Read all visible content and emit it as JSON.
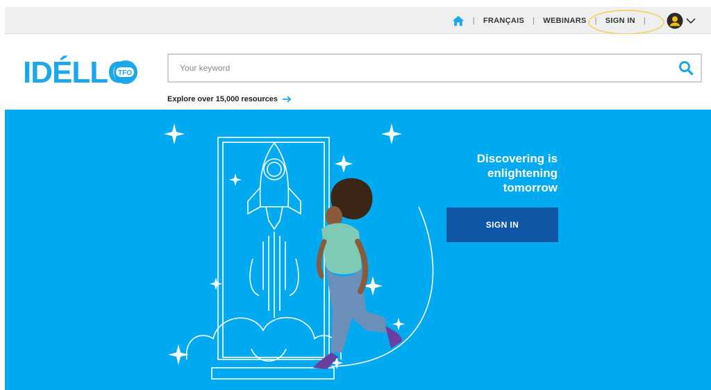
{
  "topbar": {
    "nav": [
      {
        "label": "FRANÇAIS"
      },
      {
        "label": "WEBINARS"
      },
      {
        "label": "SIGN IN"
      }
    ],
    "separator": "|"
  },
  "logo": {
    "text": "IDÉLLO",
    "badge": "TFO"
  },
  "search": {
    "placeholder": "Your keyword",
    "value": ""
  },
  "explore": {
    "label": "Explore over 15,000 resources"
  },
  "hero": {
    "tagline": [
      "Discovering is",
      "enlightening",
      "tomorrow"
    ],
    "button_label": "SIGN IN"
  },
  "colors": {
    "hero_bg": "#00aaf1",
    "brand_blue": "#1ba7ea",
    "button_bg": "#0f56a6",
    "topbar_bg": "#efefef",
    "highlight": "#f3d66b"
  },
  "icons": [
    "home-icon",
    "avatar-icon",
    "chevron-down-icon",
    "search-icon",
    "arrow-right-icon"
  ]
}
